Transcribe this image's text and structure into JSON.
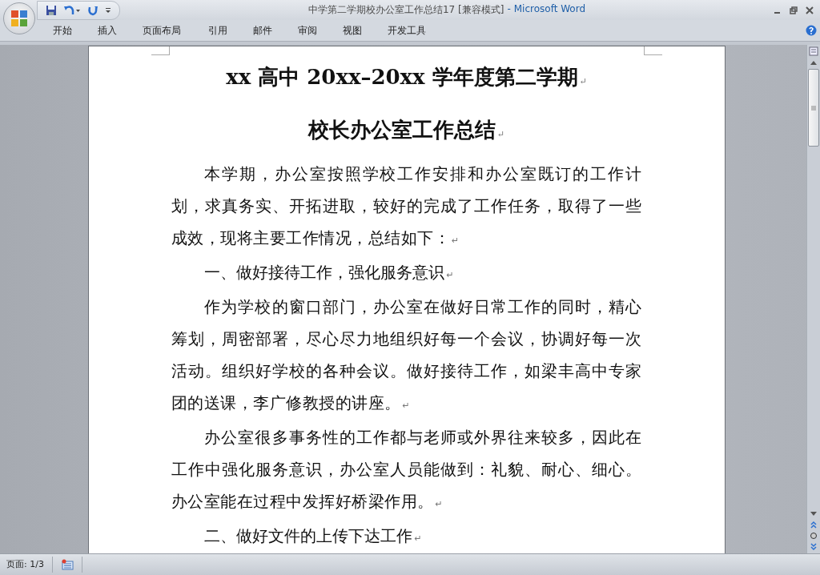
{
  "window": {
    "title": "中学第二学期校办公室工作总结17 [兼容模式]",
    "separator": "-",
    "app": "Microsoft Word"
  },
  "ribbon_tabs": [
    {
      "label": "开始",
      "selected": false
    },
    {
      "label": "插入",
      "selected": false
    },
    {
      "label": "页面布局",
      "selected": false
    },
    {
      "label": "引用",
      "selected": false
    },
    {
      "label": "邮件",
      "selected": false
    },
    {
      "label": "审阅",
      "selected": false
    },
    {
      "label": "视图",
      "selected": false
    },
    {
      "label": "开发工具",
      "selected": false
    }
  ],
  "document": {
    "paragraphs": [
      {
        "kind": "title",
        "text": "xx 高中 20xx–20xx 学年度第二学期",
        "mark": "↵"
      },
      {
        "kind": "title",
        "text": "校长办公室工作总结",
        "mark": "↵"
      },
      {
        "kind": "body",
        "text": "本学期，办公室按照学校工作安排和办公室既订的工作计划，求真务实、开拓进取，较好的完成了工作任务，取得了一些成效，现将主要工作情况，总结如下：",
        "mark": "↵"
      },
      {
        "kind": "heading",
        "text": "一、做好接待工作，强化服务意识",
        "mark": "↵"
      },
      {
        "kind": "body",
        "text": "作为学校的窗口部门，办公室在做好日常工作的同时，精心筹划，周密部署，尽心尽力地组织好每一个会议，协调好每一次活动。组织好学校的各种会议。做好接待工作，如梁丰高中专家团的送课，李广修教授的讲座。",
        "mark": "↵"
      },
      {
        "kind": "body",
        "text": "办公室很多事务性的工作都与老师或外界往来较多，因此在工作中强化服务意识，办公室人员能做到：礼貌、耐心、细心。办公室能在过程中发挥好桥梁作用。",
        "mark": "↵"
      },
      {
        "kind": "heading",
        "text": "二、做好文件的上传下达工作",
        "mark": "↵"
      }
    ]
  },
  "status_bar": {
    "page": "页面: 1/3"
  }
}
